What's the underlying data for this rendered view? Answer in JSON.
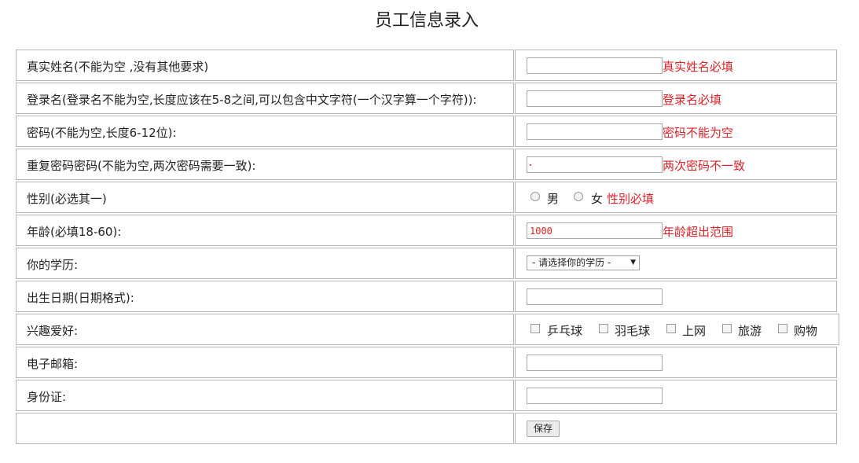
{
  "page": {
    "title": "员工信息录入"
  },
  "rows": [
    {
      "label": "真实姓名(不能为空 ,没有其他要求)",
      "value": "",
      "error": "真实姓名必填"
    },
    {
      "label": "登录名(登录名不能为空,长度应该在5-8之间,可以包含中文字符(一个汉字算一个字符)):",
      "value": "",
      "error": "登录名必填"
    },
    {
      "label": "密码(不能为空,长度6-12位):",
      "value": "",
      "error": "密码不能为空"
    },
    {
      "label": "重复密码密码(不能为空,两次密码需要一致):",
      "value": "",
      "error": "两次密码不一致"
    },
    {
      "label": "性别(必选其一)",
      "options": [
        "男",
        "女"
      ],
      "error": "性别必填"
    },
    {
      "label": "年龄(必填18-60):",
      "value": "1000",
      "error": "年龄超出范围"
    },
    {
      "label": "你的学历:",
      "selected": "- 请选择你的学历 -"
    },
    {
      "label": "出生日期(日期格式):",
      "value": ""
    },
    {
      "label": "兴趣爱好:",
      "options": [
        "乒乓球",
        "羽毛球",
        "上网",
        "旅游",
        "购物"
      ]
    },
    {
      "label": "电子邮箱:",
      "value": ""
    },
    {
      "label": "身份证:",
      "value": ""
    },
    {
      "label": "",
      "button": "保存"
    }
  ],
  "colors": {
    "error": "#d8232a",
    "border": "#b5b5b5"
  }
}
